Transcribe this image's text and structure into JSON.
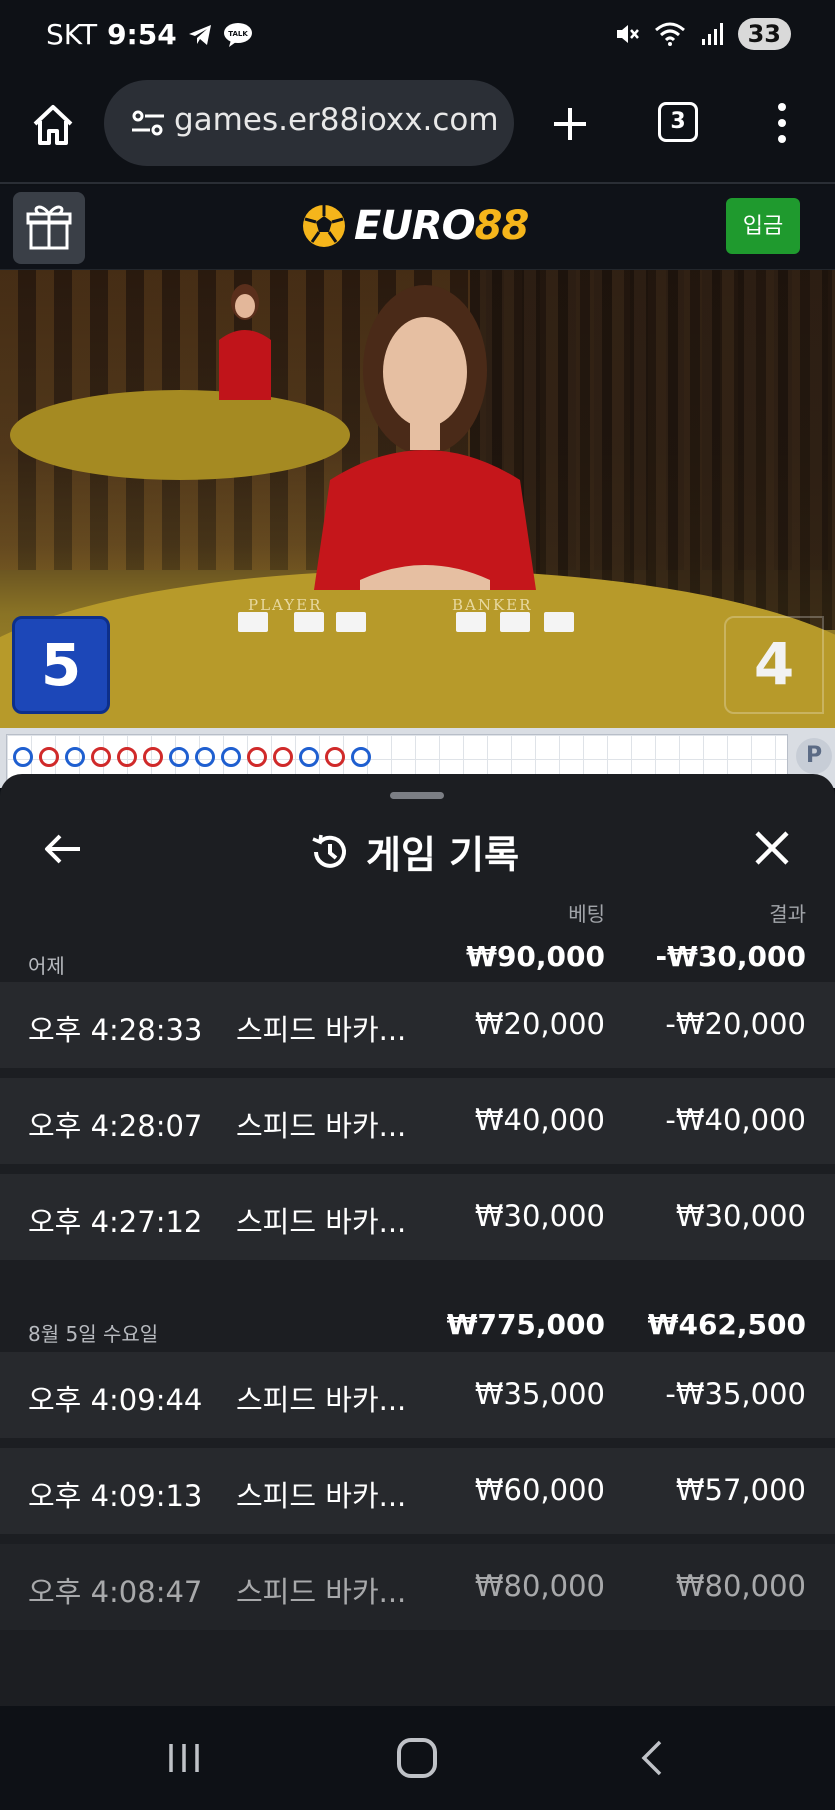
{
  "status_bar": {
    "carrier": "SKT",
    "time": "9:54",
    "battery": "33",
    "icons": [
      "telegram-icon",
      "kakaotalk-icon",
      "mute-icon",
      "wifi-icon",
      "signal-icon"
    ]
  },
  "browser": {
    "url": "games.er88ioxx.com",
    "tab_count": "3"
  },
  "site": {
    "logo_part1": "EURO",
    "logo_part2": "88",
    "deposit_label": "입금",
    "brand_color": "#f5b51b",
    "deposit_color": "#1f9a2e"
  },
  "game": {
    "player_label": "PLAYER",
    "banker_label": "BANKER",
    "player_score": "5",
    "banker_score": "4",
    "roadmap_side": "P"
  },
  "history": {
    "title": "게임 기록",
    "bet_header": "베팅",
    "result_header": "결과",
    "groups": [
      {
        "date": "어제",
        "bet_total": "₩90,000",
        "result_total": "-₩30,000",
        "rows": [
          {
            "time": "오후 4:28:33",
            "game": "스피드 바카...",
            "bet": "₩20,000",
            "result": "-₩20,000"
          },
          {
            "time": "오후 4:28:07",
            "game": "스피드 바카...",
            "bet": "₩40,000",
            "result": "-₩40,000"
          },
          {
            "time": "오후 4:27:12",
            "game": "스피드 바카...",
            "bet": "₩30,000",
            "result": "₩30,000"
          }
        ]
      },
      {
        "date": "8월 5일 수요일",
        "bet_total": "₩775,000",
        "result_total": "₩462,500",
        "rows": [
          {
            "time": "오후 4:09:44",
            "game": "스피드 바카...",
            "bet": "₩35,000",
            "result": "-₩35,000"
          },
          {
            "time": "오후 4:09:13",
            "game": "스피드 바카...",
            "bet": "₩60,000",
            "result": "₩57,000"
          },
          {
            "time": "오후 4:08:47",
            "game": "스피드 바카...",
            "bet": "₩80,000",
            "result": "₩80,000"
          }
        ]
      }
    ]
  }
}
